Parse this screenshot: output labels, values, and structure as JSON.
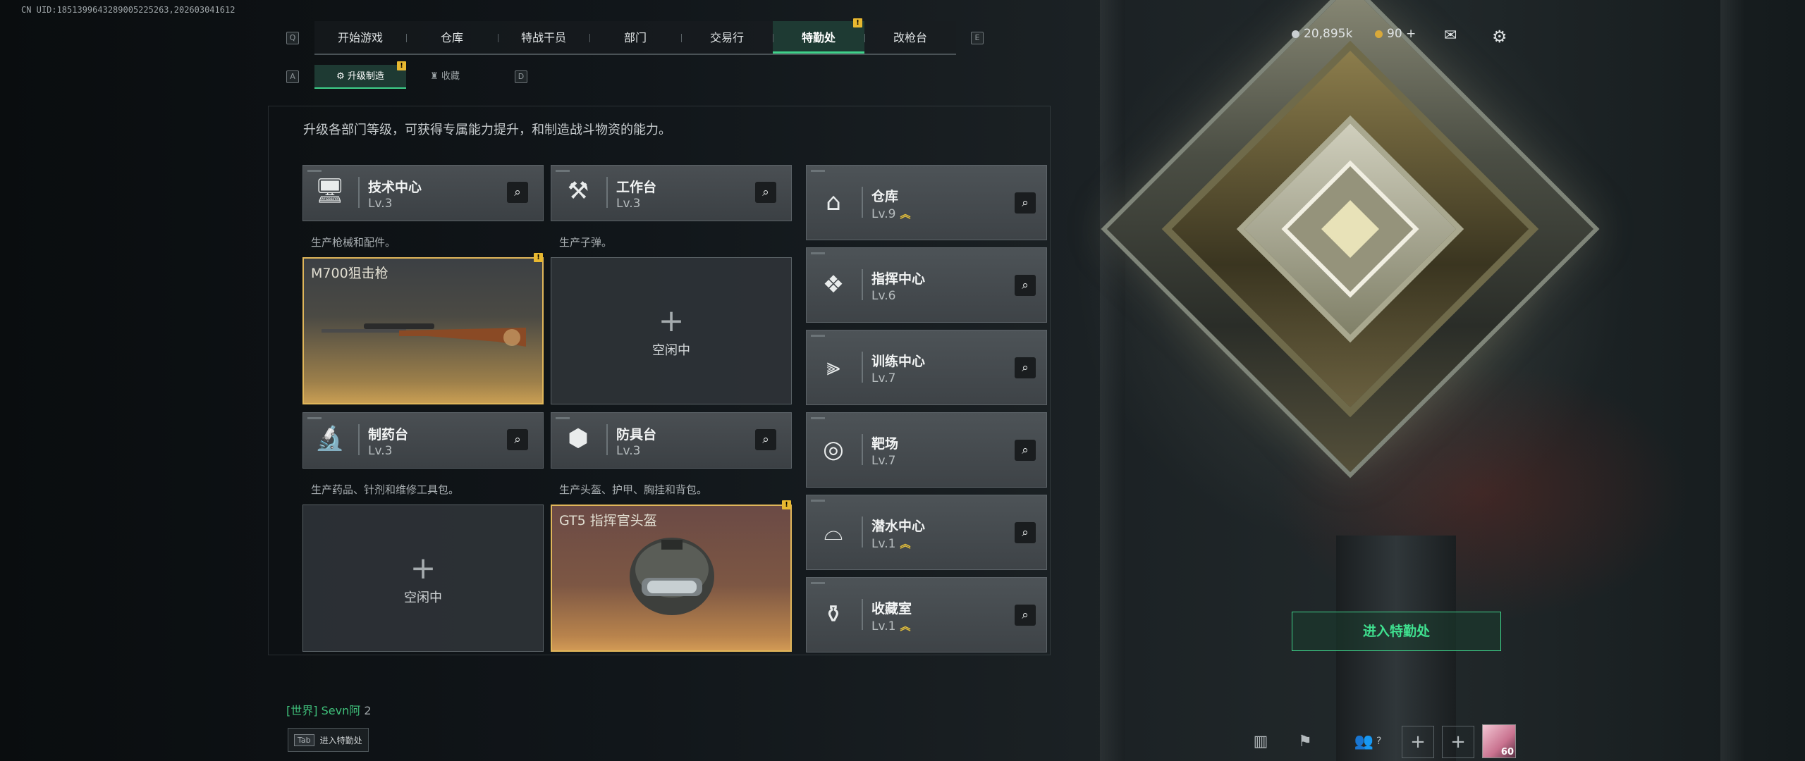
{
  "uid": "CN UID:18513996432890052252​63,202603041612",
  "topnav": {
    "left_key": "Q",
    "right_key": "E",
    "tabs": [
      "开始游戏",
      "仓库",
      "特战干员",
      "部门",
      "交易行",
      "特勤处",
      "改枪台"
    ],
    "active_index": 5,
    "badge": "!"
  },
  "resources": {
    "coins": "20,895k",
    "gems": "90 +"
  },
  "icons": {
    "mail": "mail-icon",
    "settings": "gear-icon"
  },
  "subnav": {
    "left_key": "A",
    "right_key": "D",
    "tabs": [
      "升级制造",
      "收藏"
    ],
    "badge": "!"
  },
  "description": "升级各部门等级，可获得专属能力提升，和制造战斗物资的能力。",
  "workshops": [
    {
      "title": "技术中心",
      "level": "Lv.3",
      "desc": "生产枪械和配件。",
      "slot_state": "filled",
      "item": "M700狙击枪",
      "badge": "!",
      "idle": "空闲中"
    },
    {
      "title": "工作台",
      "level": "Lv.3",
      "desc": "生产子弹。",
      "slot_state": "idle",
      "item": "",
      "idle": "空闲中"
    },
    {
      "title": "制药台",
      "level": "Lv.3",
      "desc": "生产药品、针剂和维修工具包。",
      "slot_state": "idle",
      "item": "",
      "idle": "空闲中"
    },
    {
      "title": "防具台",
      "level": "Lv.3",
      "desc": "生产头盔、护甲、胸挂和背包。",
      "slot_state": "filled",
      "item": "GT5 指挥官头盔",
      "badge": "!",
      "idle": "空闲中"
    }
  ],
  "facilities": [
    {
      "title": "仓库",
      "level": "Lv.9",
      "upgradable": true,
      "icon": "warehouse-icon"
    },
    {
      "title": "指挥中心",
      "level": "Lv.6",
      "upgradable": false,
      "icon": "command-icon"
    },
    {
      "title": "训练中心",
      "level": "Lv.7",
      "upgradable": false,
      "icon": "dumbbell-icon"
    },
    {
      "title": "靶场",
      "level": "Lv.7",
      "upgradable": false,
      "icon": "target-icon"
    },
    {
      "title": "潜水中心",
      "level": "Lv.1",
      "upgradable": true,
      "icon": "diving-mask-icon"
    },
    {
      "title": "收藏室",
      "level": "Lv.1",
      "upgradable": true,
      "icon": "collection-icon"
    }
  ],
  "enter_button": "进入特勤处",
  "chat": {
    "channel": "[世界]",
    "user": "Sevn阿",
    "count": "2"
  },
  "tab_hint": {
    "key": "Tab",
    "label": "进入特勤处"
  },
  "bottom": {
    "friends_count": "?",
    "avatar_level": "60"
  }
}
